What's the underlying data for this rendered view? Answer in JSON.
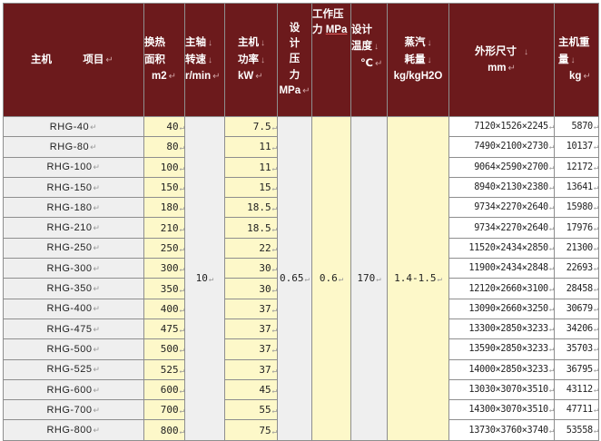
{
  "headers": {
    "model": "主机",
    "item": "项目",
    "area_l1": "换热",
    "area_l2": "面积",
    "area_unit": "m2",
    "speed_l1": "主轴",
    "speed_l2": "转速",
    "speed_unit": "r/min",
    "power_l1": "主机",
    "power_l2": "功率",
    "power_unit": "kW",
    "dp_l1": "设",
    "dp_l2": "计",
    "dp_l3": "压",
    "dp_l4": "力",
    "dp_unit": "MPa",
    "wp_l1": "工作压",
    "wp_l2": "力",
    "wp_unit": "MPa",
    "temp_l1": "设计",
    "temp_l2": "温度",
    "temp_unit": "℃",
    "steam_l1": "蒸汽",
    "steam_l2": "耗量",
    "steam_unit": "kg/kgH2O",
    "dims_label": "外形尺寸",
    "dims_unit": "mm",
    "weight_l1": "主机重",
    "weight_l2": "量",
    "weight_unit": "kg"
  },
  "merged": {
    "speed": "10",
    "design_pressure": "0.65",
    "working_pressure": "0.6",
    "design_temp": "170",
    "steam": "1.4-1.5"
  },
  "rows": [
    {
      "model": "RHG-40",
      "area": "40",
      "power": "7.5",
      "dims": "7120×1526×2245",
      "weight": "5870"
    },
    {
      "model": "RHG-80",
      "area": "80",
      "power": "11",
      "dims": "7490×2100×2730",
      "weight": "10137"
    },
    {
      "model": "RHG-100",
      "area": "100",
      "power": "11",
      "dims": "9064×2590×2700",
      "weight": "12172"
    },
    {
      "model": "RHG-150",
      "area": "150",
      "power": "15",
      "dims": "8940×2130×2380",
      "weight": "13641"
    },
    {
      "model": "RHG-180",
      "area": "180",
      "power": "18.5",
      "dims": "9734×2270×2640",
      "weight": "15980"
    },
    {
      "model": "RHG-210",
      "area": "210",
      "power": "18.5",
      "dims": "9734×2270×2640",
      "weight": "17976"
    },
    {
      "model": "RHG-250",
      "area": "250",
      "power": "22",
      "dims": "11520×2434×2850",
      "weight": "21300"
    },
    {
      "model": "RHG-300",
      "area": "300",
      "power": "30",
      "dims": "11900×2434×2848",
      "weight": "22693"
    },
    {
      "model": "RHG-350",
      "area": "350",
      "power": "30",
      "dims": "12120×2660×3100",
      "weight": "28458"
    },
    {
      "model": "RHG-400",
      "area": "400",
      "power": "37",
      "dims": "13090×2660×3250",
      "weight": "30679"
    },
    {
      "model": "RHG-475",
      "area": "475",
      "power": "37",
      "dims": "13300×2850×3233",
      "weight": "34206"
    },
    {
      "model": "RHG-500",
      "area": "500",
      "power": "37",
      "dims": "13590×2850×3233",
      "weight": "35703"
    },
    {
      "model": "RHG-525",
      "area": "525",
      "power": "37",
      "dims": "14000×2850×3233",
      "weight": "36795"
    },
    {
      "model": "RHG-600",
      "area": "600",
      "power": "45",
      "dims": "13030×3070×3510",
      "weight": "43112"
    },
    {
      "model": "RHG-700",
      "area": "700",
      "power": "55",
      "dims": "14300×3070×3510",
      "weight": "47711"
    },
    {
      "model": "RHG-800",
      "area": "800",
      "power": "75",
      "dims": "13730×3760×3740",
      "weight": "53558"
    }
  ],
  "colors": {
    "header_bg": "#6c1a1c",
    "yellow_cell": "#fdf8c9",
    "grey_cell": "#efefef"
  }
}
